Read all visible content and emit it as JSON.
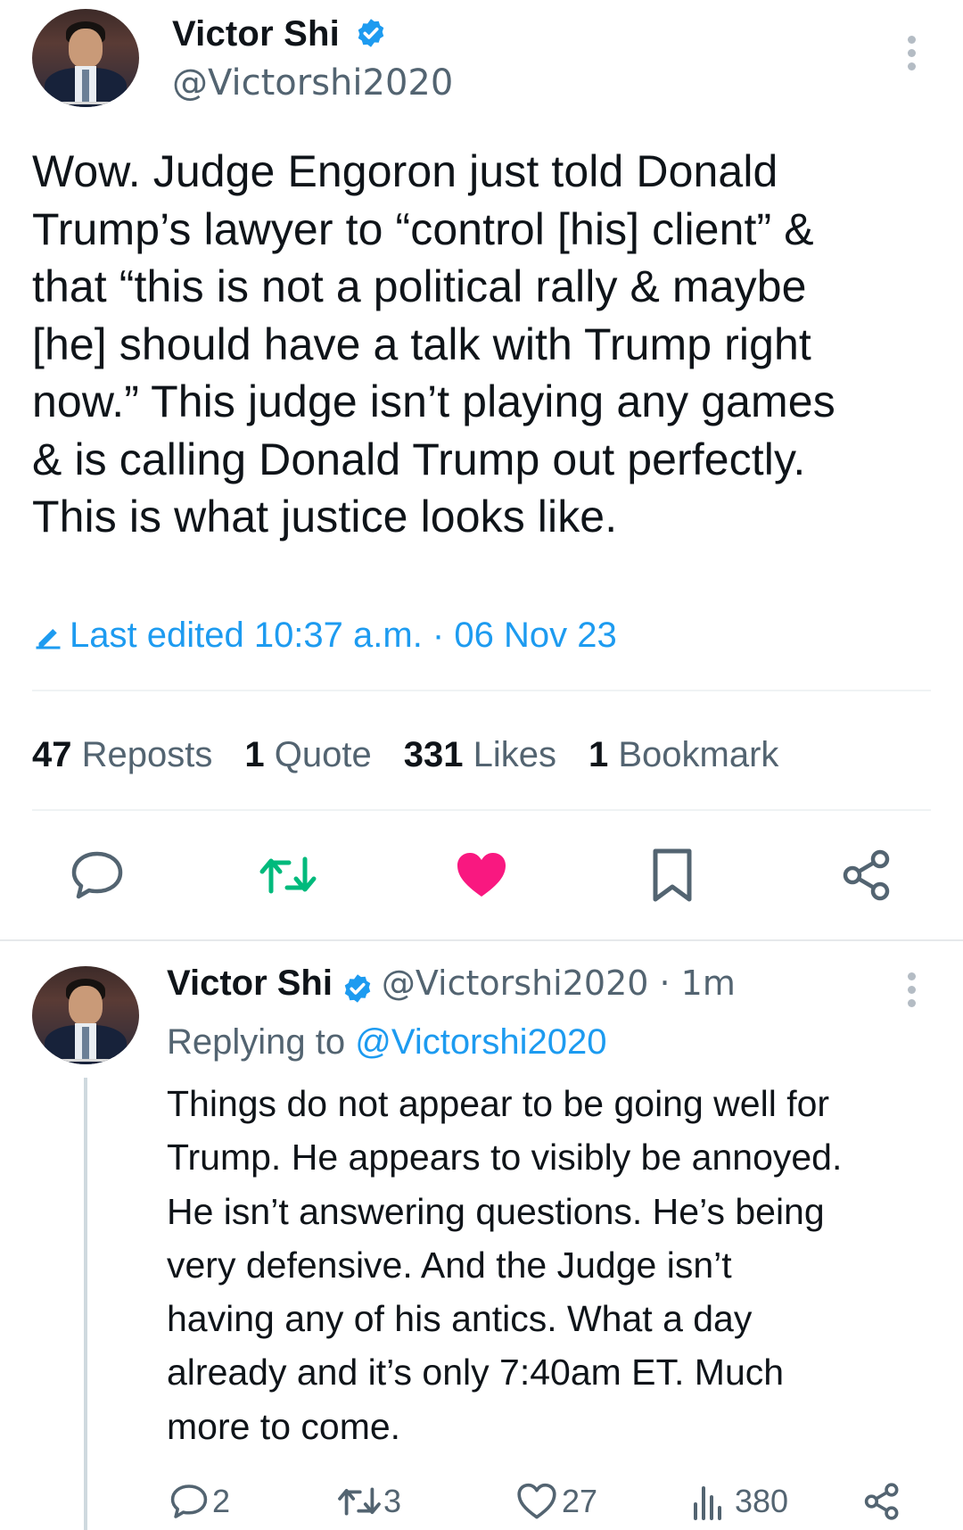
{
  "main_tweet": {
    "author_name": "Victor Shi",
    "handle": "@Victorshi2020",
    "text_lines": [
      "Wow. Judge Engoron just told Donald",
      "Trump’s lawyer to “control [his] client” &",
      "that “this is not a political rally & maybe",
      "[he] should have a talk with Trump right",
      "now.” This judge isn’t playing any games",
      "& is calling Donald Trump out perfectly.",
      "This is what justice looks like."
    ],
    "edited_label": "Last edited 10:37 a.m. · 06 Nov 23",
    "stats": {
      "reposts_count": "47",
      "reposts_label": "Reposts",
      "quotes_count": "1",
      "quotes_label": "Quote",
      "likes_count": "331",
      "likes_label": "Likes",
      "bookmarks_count": "1",
      "bookmarks_label": "Bookmark"
    },
    "actions": [
      "reply-icon",
      "repost-icon",
      "like-icon",
      "bookmark-icon",
      "share-icon"
    ],
    "liked": true
  },
  "reply_tweet": {
    "author_name": "Victor Shi",
    "handle_time": "@Victorshi2020 · 1m",
    "replying_prefix": "Replying to",
    "replying_handle": "@Victorshi2020",
    "text_lines": [
      "Things do not appear to be going well for",
      "Trump. He appears to visibly be annoyed.",
      "He isn’t answering questions. He’s being",
      "very defensive. And the Judge isn’t",
      "having any of his antics. What a day",
      "already and it’s only 7:40am ET. Much",
      "more to come."
    ],
    "counts": {
      "replies": "2",
      "reposts": "3",
      "likes": "27",
      "views": "380"
    }
  },
  "colors": {
    "accent_blue": "#1d9bf0",
    "like_pink": "#f91880",
    "repost_green": "#00ba7c",
    "secondary_text": "#536471"
  }
}
